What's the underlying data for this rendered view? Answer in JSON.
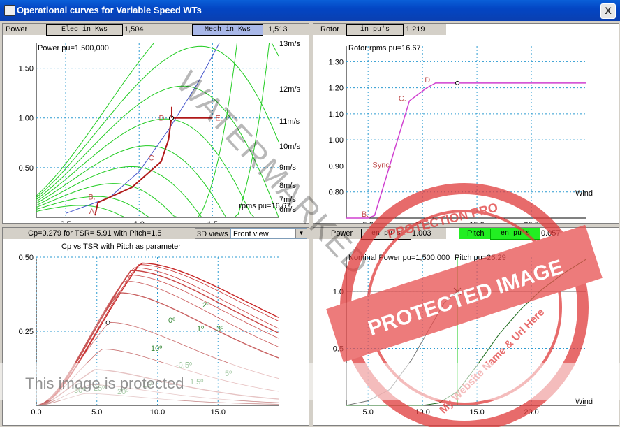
{
  "window": {
    "title": "Operational curves for Variable Speed WTs",
    "close": "X"
  },
  "power_panel": {
    "label": "Power",
    "elec_button": "Elec in Kws",
    "elec_value": "1,504",
    "mech_button": "Mech in Kws",
    "mech_value": "1,513",
    "caption": "Power pu=1,500,000",
    "rpm_note": "rpms pu=16.67",
    "wind_labels": [
      "13m/s",
      "12m/s",
      "11m/s",
      "10m/s",
      "9m/s",
      "8m/s",
      "7m/s",
      "6m/s"
    ],
    "point_labels": [
      "B.",
      "A.",
      "C",
      "D",
      "E."
    ]
  },
  "rotor_panel": {
    "label": "Rotor",
    "button": "in pu's",
    "value": "1.219",
    "caption": "Rotor rpms pu=16.67",
    "xaxis": "Wind",
    "point_labels": [
      "B.",
      "Sync.",
      "C.",
      "D."
    ]
  },
  "cp_panel": {
    "caption_bar": "Cp=0.279 for TSR= 5.91  with Pitch=1.5",
    "view_button": "3D views",
    "view_select": "Front view",
    "caption": "Cp vs TSR with Pitch as parameter",
    "pitch_labels": [
      "2º",
      "0º",
      "1º",
      "3º",
      "10º",
      "-0.5º",
      "5º",
      "1.5º",
      "30º",
      "25º",
      "20º",
      "15º"
    ]
  },
  "bottom_right_panel": {
    "power_label": "Power",
    "power_button": "en pu's",
    "power_value": "1.003",
    "pitch_label": "Pitch",
    "pitch_button": "en pu's",
    "pitch_value": "0.057",
    "caption_power": "Nominal Power pu=1,500,000",
    "caption_pitch": "Pitch pu=26.29",
    "xaxis": "Wind"
  },
  "watermarks": {
    "diagonal": "WATERMARKED",
    "bottom": "This image is protected",
    "stamp": "PROTECTED IMAGE",
    "stamp_ring": "PROTECTION PRO",
    "stamp_sub": "My Website Name & Url Here"
  },
  "chart_data": [
    {
      "type": "line",
      "title": "Power pu=1,500,000",
      "x_ticks": [
        "0.5",
        "1.0",
        "1.5"
      ],
      "y_ticks": [
        "0.50",
        "1.00",
        "1.50"
      ],
      "xlim": [
        0.3,
        1.95
      ],
      "ylim": [
        0,
        1.75
      ],
      "series_wind": [
        {
          "name": "13m/s",
          "peak_x": 1.55,
          "peak_y": 2.2
        },
        {
          "name": "12m/s",
          "peak_x": 1.42,
          "peak_y": 1.72
        },
        {
          "name": "11m/s",
          "peak_x": 1.3,
          "peak_y": 1.32
        },
        {
          "name": "10m/s",
          "peak_x": 1.18,
          "peak_y": 0.99
        },
        {
          "name": "9m/s",
          "peak_x": 1.06,
          "peak_y": 0.72
        },
        {
          "name": "8m/s",
          "peak_x": 0.95,
          "peak_y": 0.51
        },
        {
          "name": "7m/s",
          "peak_x": 0.83,
          "peak_y": 0.34
        },
        {
          "name": "6m/s",
          "peak_x": 0.71,
          "peak_y": 0.21
        },
        {
          "name": "5m/s",
          "peak_x": 0.6,
          "peak_y": 0.12
        }
      ],
      "operating_curve": {
        "x": [
          0.7,
          0.72,
          0.95,
          1.15,
          1.2,
          1.22,
          1.5
        ],
        "y": [
          0.02,
          0.15,
          0.3,
          0.56,
          0.78,
          1.0,
          1.0
        ]
      },
      "blue_curve": {
        "x": [
          0.5,
          0.8,
          1.0,
          1.2,
          1.4,
          1.6
        ],
        "y": [
          0.04,
          0.2,
          0.46,
          0.88,
          1.35,
          1.9
        ]
      }
    },
    {
      "type": "line",
      "title": "Rotor rpms pu=16.67",
      "x_ticks": [
        "5.0",
        "10.0",
        "15.0",
        "20.0"
      ],
      "y_ticks": [
        "0.80",
        "0.90",
        "1.00",
        "1.10",
        "1.20",
        "1.30"
      ],
      "xlim": [
        3,
        25
      ],
      "ylim": [
        0.7,
        1.36
      ],
      "series": [
        {
          "x": [
            3,
            5,
            5.6,
            8.8,
            10.4,
            11.2,
            25
          ],
          "y": [
            0.7,
            0.7,
            0.71,
            1.15,
            1.2,
            1.218,
            1.218
          ]
        }
      ],
      "marker": {
        "x": 13.2,
        "y": 1.218
      }
    },
    {
      "type": "line",
      "title": "Cp vs TSR with Pitch as parameter",
      "x_ticks": [
        "0.0",
        "5.0",
        "10.0",
        "15.0"
      ],
      "y_ticks": [
        "0.25",
        "0.50"
      ],
      "xlim": [
        0,
        20
      ],
      "ylim": [
        0,
        0.5
      ],
      "pitch_curves": [
        {
          "pitch": -0.5,
          "peak_x": 8.6,
          "peak_y": 0.48
        },
        {
          "pitch": 0,
          "peak_x": 8.4,
          "peak_y": 0.475
        },
        {
          "pitch": 1,
          "peak_x": 8.0,
          "peak_y": 0.465
        },
        {
          "pitch": 1.5,
          "peak_x": 7.8,
          "peak_y": 0.455
        },
        {
          "pitch": 2,
          "peak_x": 7.6,
          "peak_y": 0.44
        },
        {
          "pitch": 3,
          "peak_x": 7.2,
          "peak_y": 0.42
        },
        {
          "pitch": 5,
          "peak_x": 6.8,
          "peak_y": 0.38
        },
        {
          "pitch": 10,
          "peak_x": 6.0,
          "peak_y": 0.28
        },
        {
          "pitch": 15,
          "peak_x": 5.4,
          "peak_y": 0.19
        },
        {
          "pitch": 20,
          "peak_x": 4.8,
          "peak_y": 0.12
        },
        {
          "pitch": 25,
          "peak_x": 4.4,
          "peak_y": 0.07
        },
        {
          "pitch": 30,
          "peak_x": 4.0,
          "peak_y": 0.04
        }
      ],
      "marker": {
        "x": 5.91,
        "y": 0.279
      }
    },
    {
      "type": "line",
      "title": "Nominal Power pu=1,500,000",
      "x_ticks": [
        "5.0",
        "10.0",
        "15.0",
        "20.0"
      ],
      "y_ticks": [
        "0.5",
        "1.0"
      ],
      "xlim": [
        3,
        25
      ],
      "ylim": [
        0,
        1.3
      ],
      "power_series": {
        "x": [
          3,
          5,
          7,
          9,
          10.5,
          12,
          13.2,
          25
        ],
        "y": [
          0.0,
          0.04,
          0.14,
          0.4,
          0.65,
          0.9,
          1.0,
          1.0
        ]
      },
      "pitch_series": {
        "x": [
          3,
          10,
          11.5,
          13.2,
          15,
          17,
          19,
          21,
          23,
          25
        ],
        "y": [
          0.0,
          0.0,
          0.02,
          0.12,
          0.35,
          0.62,
          0.84,
          1.02,
          1.16,
          1.28
        ]
      },
      "marker": {
        "x": 13.2,
        "y": 1.0
      }
    }
  ]
}
